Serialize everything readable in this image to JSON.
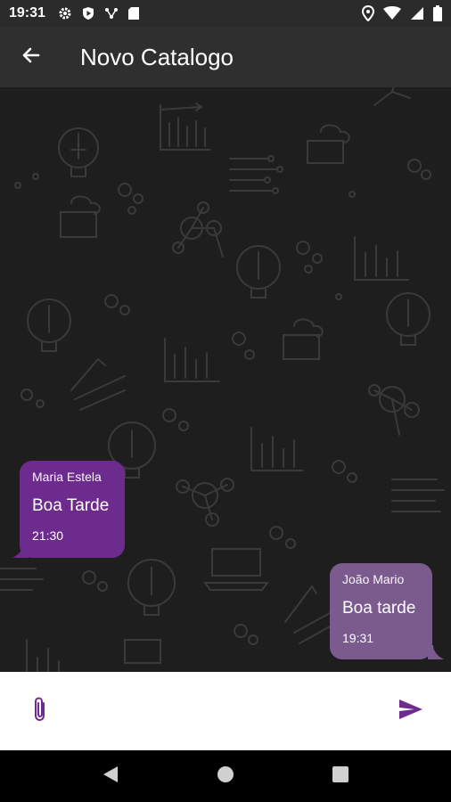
{
  "status_bar": {
    "time": "19:31",
    "left_icons": [
      "settings-icon",
      "shield-play-icon",
      "network-icon",
      "sd-card-icon"
    ],
    "right_icons": [
      "location-icon",
      "wifi-icon",
      "signal-icon",
      "battery-icon"
    ]
  },
  "app_bar": {
    "back_icon": "arrow-back-icon",
    "title": "Novo Catalogo"
  },
  "messages": [
    {
      "sender": "Maria Estela",
      "text": "Boa Tarde",
      "time": "21:30",
      "side": "left",
      "color": "#6e2b8e"
    },
    {
      "sender": "João Mario",
      "text": "Boa tarde",
      "time": "19:31",
      "side": "right",
      "color": "#7b5a8e"
    }
  ],
  "composer": {
    "attach_icon": "paperclip-icon",
    "input_value": "",
    "input_placeholder": "",
    "send_icon": "send-icon",
    "accent": "#6e2b8e"
  },
  "nav_bar": {
    "buttons": [
      "back-triangle-icon",
      "home-circle-icon",
      "recents-square-icon"
    ]
  },
  "colors": {
    "chat_background": "#1e1e1e",
    "app_bar": "#2f2f2f",
    "status_bar": "#2b2b2b"
  }
}
